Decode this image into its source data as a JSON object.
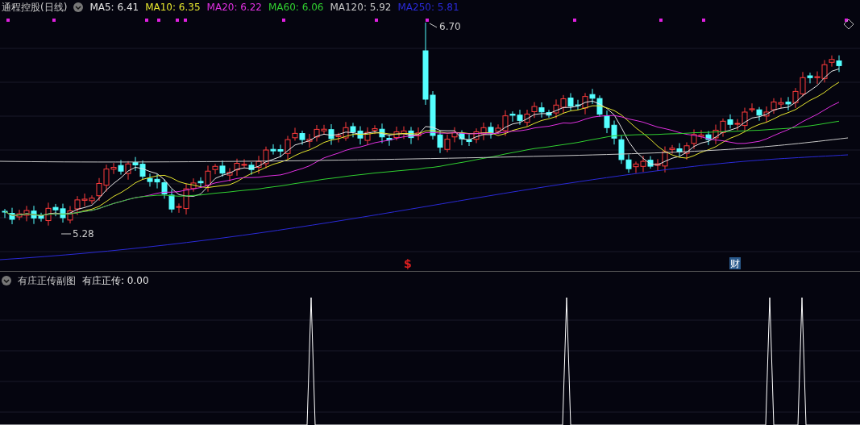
{
  "chart": {
    "title": "通程控股",
    "period": "(日线)",
    "ma": [
      {
        "label": "MA5: 6.41",
        "color": "#e6e6e6"
      },
      {
        "label": "MA10: 6.35",
        "color": "#e6e62e"
      },
      {
        "label": "MA20: 6.22",
        "color": "#e030e0"
      },
      {
        "label": "MA60: 6.06",
        "color": "#30d030"
      },
      {
        "label": "MA120: 5.92",
        "color": "#c8c8c8"
      },
      {
        "label": "MA250: 5.81",
        "color": "#2a2ad8"
      }
    ],
    "high_label": "6.70",
    "low_label": "5.28",
    "events": [
      {
        "kind": "text",
        "text": "$",
        "color": "#e02020"
      },
      {
        "kind": "badge",
        "text": "财",
        "color": "#2a5a8c"
      }
    ]
  },
  "sub_chart": {
    "title": "有庄正传副图",
    "reading": "有庄正传: 0.00"
  }
}
